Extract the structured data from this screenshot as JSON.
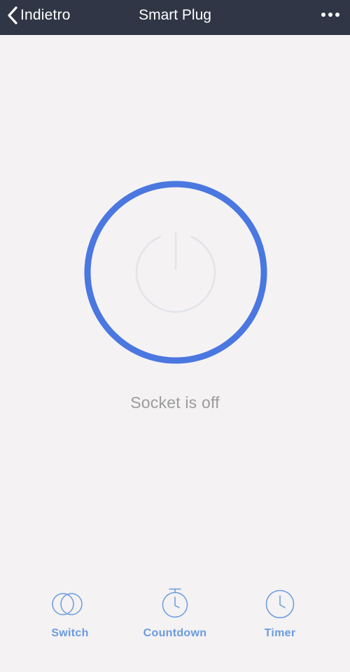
{
  "header": {
    "back_label": "Indietro",
    "title": "Smart Plug",
    "menu_icon": "more-dots-icon"
  },
  "power": {
    "icon": "power-icon",
    "state": "off",
    "ring_color": "#4a77e0",
    "status_text": "Socket is off"
  },
  "tabs": [
    {
      "label": "Switch",
      "icon": "switch-toggle-icon"
    },
    {
      "label": "Countdown",
      "icon": "stopwatch-icon"
    },
    {
      "label": "Timer",
      "icon": "clock-icon"
    }
  ],
  "colors": {
    "header_bg": "#303645",
    "page_bg": "#f4f2f3",
    "accent": "#6a9be0",
    "status_text": "#9c9c9c"
  }
}
